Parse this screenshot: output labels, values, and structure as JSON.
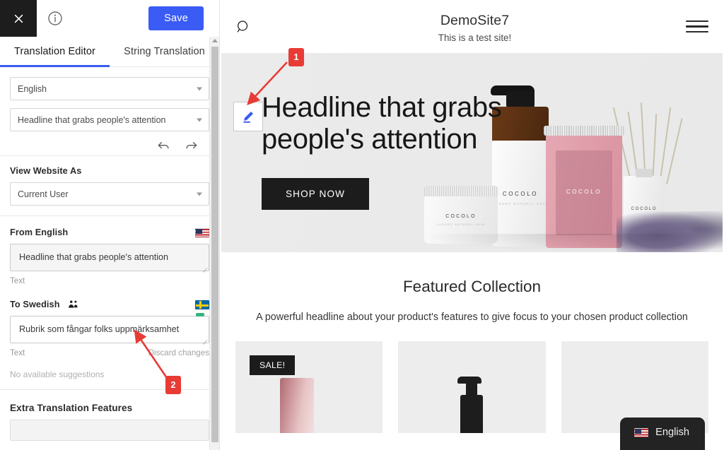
{
  "editor": {
    "close_icon": "close-icon",
    "info_icon": "info-icon",
    "save_label": "Save",
    "accent_color": "#3b5bf5",
    "tabs": [
      {
        "label": "Translation Editor",
        "active": true
      },
      {
        "label": "String Translation",
        "active": false
      }
    ],
    "language_select": {
      "value": "English",
      "caret_icon": "chevron-down-icon"
    },
    "string_select": {
      "value": "Headline that grabs people's attention",
      "caret_icon": "chevron-down-icon"
    },
    "history": {
      "undo_icon": "undo-arrow-icon",
      "redo_icon": "redo-arrow-icon"
    },
    "view_as": {
      "label": "View Website As",
      "select_value": "Current User",
      "caret_icon": "chevron-down-icon"
    },
    "source": {
      "label": "From English",
      "flag_icon": "flag-us-icon",
      "value": "Headline that grabs people's attention",
      "type_label": "Text"
    },
    "target": {
      "label": "To Swedish",
      "team_icon": "people-icon",
      "flag_icon": "flag-se-icon",
      "value": "Rubrik som fångar folks uppmärksamhet",
      "type_label": "Text",
      "discard_label": "Discard changes",
      "suggestions_label": "No available suggestions",
      "status_color": "#35b37e"
    },
    "extra": {
      "label": "Extra Translation Features"
    },
    "scrollbar": {
      "up_arrow_icon": "scroll-up-arrow-icon"
    }
  },
  "preview": {
    "header": {
      "search_icon": "search-icon",
      "menu_icon": "hamburger-menu-icon",
      "site_title": "DemoSite7",
      "site_tagline": "This is a test site!"
    },
    "hero": {
      "edit_icon": "pencil-edit-icon",
      "headline": "Headline that grabs people's attention",
      "cta_label": "SHOP NOW",
      "product_brand": "COCOLO",
      "product_brand_sub": "LUXURY NATURAL SKIN"
    },
    "featured": {
      "title": "Featured Collection",
      "subtitle": "A powerful headline about your product's features to give focus to your chosen product collection",
      "cards": [
        {
          "badge": "SALE!"
        },
        {
          "badge": ""
        },
        {
          "badge": ""
        }
      ]
    },
    "language_switcher": {
      "flag_icon": "flag-us-icon",
      "label": "English"
    }
  },
  "annotations": [
    {
      "number": "1",
      "color": "#e83b36"
    },
    {
      "number": "2",
      "color": "#e83b36"
    }
  ]
}
